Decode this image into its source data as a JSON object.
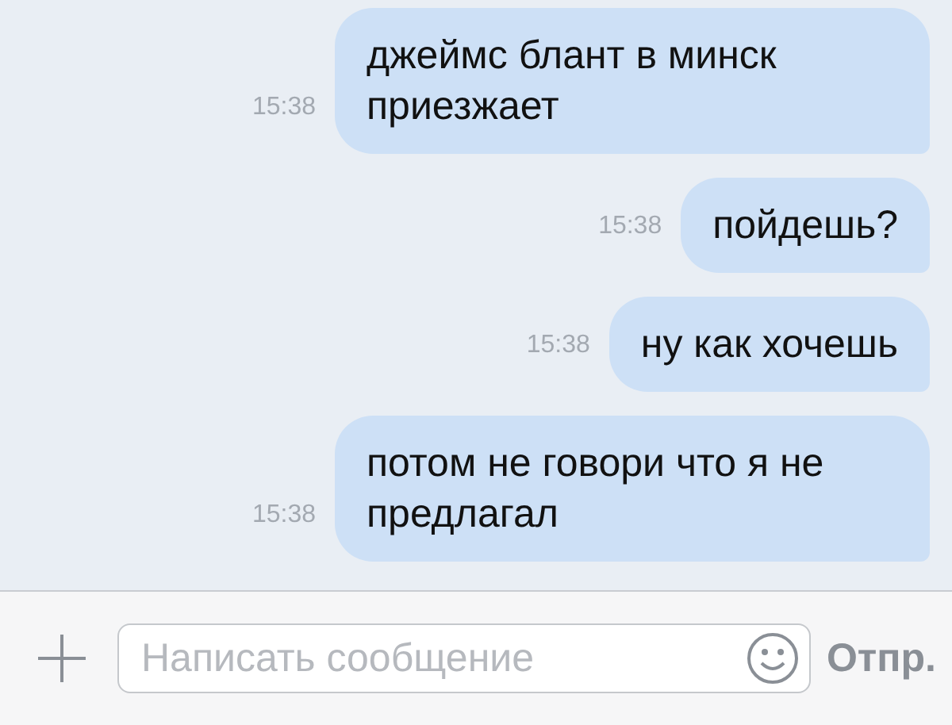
{
  "messages": [
    {
      "time": "15:38",
      "text": "джеймс блант в минск приезжает",
      "outgoing": true
    },
    {
      "time": "15:38",
      "text": "пойдешь?",
      "outgoing": true
    },
    {
      "time": "15:38",
      "text": "ну как хочешь",
      "outgoing": true
    },
    {
      "time": "15:38",
      "text": "потом не говори что я не предлагал",
      "outgoing": true
    }
  ],
  "composer": {
    "placeholder": "Написать сообщение",
    "send": "Отпр."
  }
}
